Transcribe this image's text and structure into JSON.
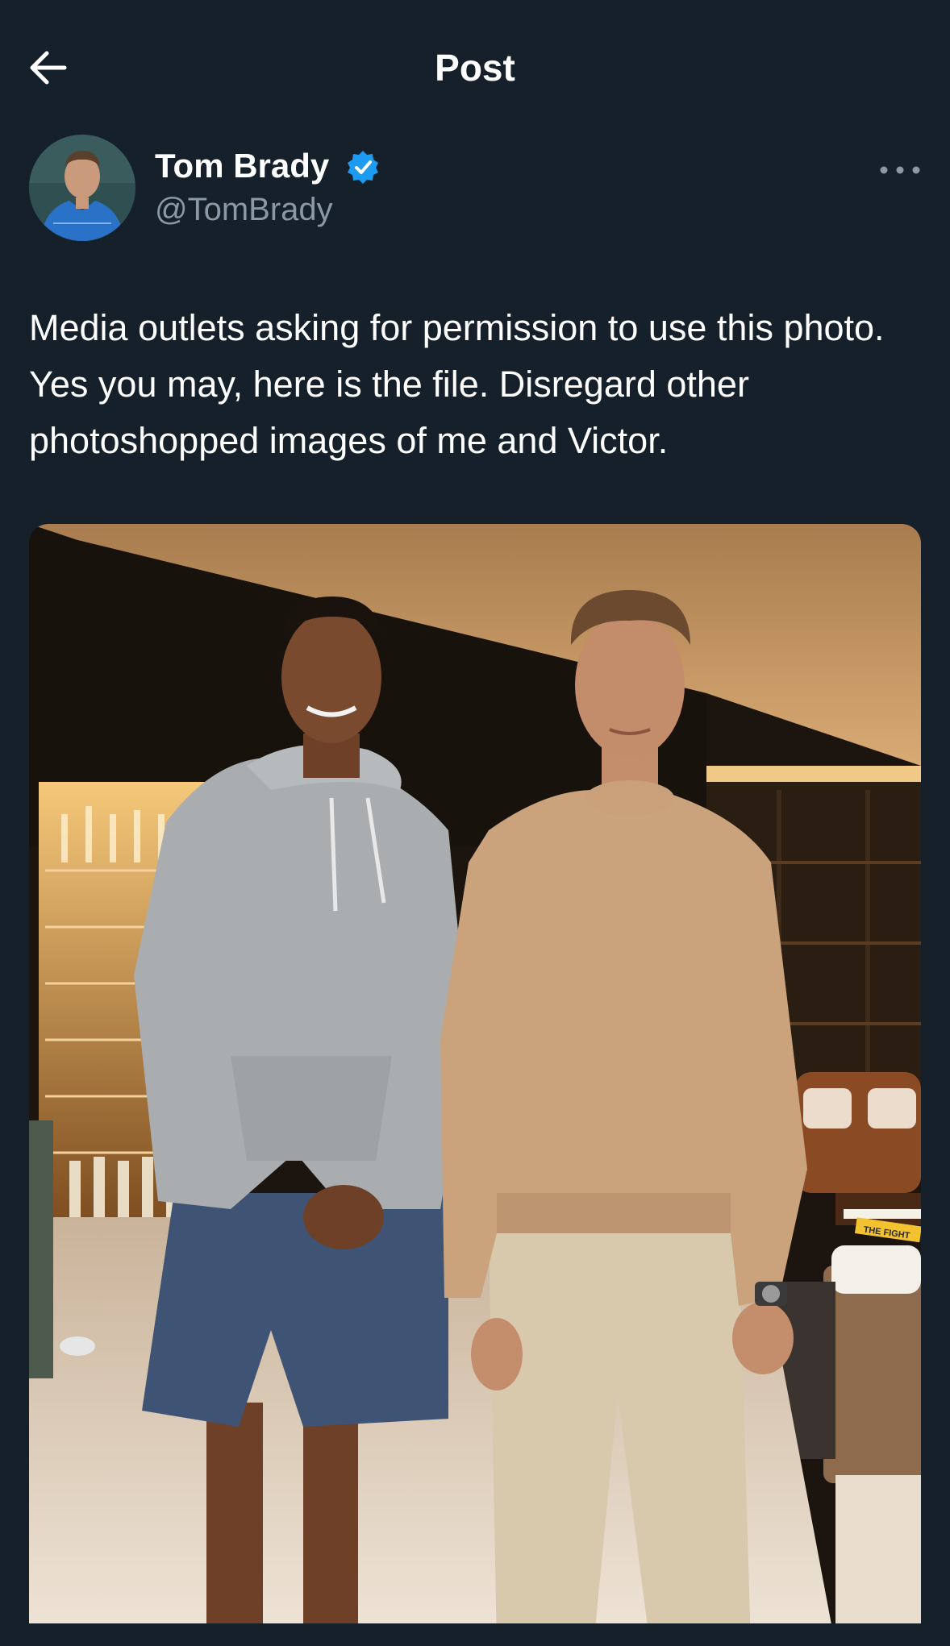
{
  "header": {
    "title": "Post",
    "back_icon": "arrow-left-icon"
  },
  "author": {
    "display_name": "Tom Brady",
    "handle": "@TomBrady",
    "verified": true,
    "verified_icon": "verified-badge-icon",
    "more_icon": "more-horizontal-icon"
  },
  "post": {
    "text": "Media outlets asking for permission to use this photo. Yes you may, here is the file. Disregard other photoshopped images of me and Victor.",
    "media": {
      "image_label": "photo",
      "book_spine_text": "THE FIGHT"
    }
  },
  "colors": {
    "background": "#15202b",
    "text_primary": "#ffffff",
    "text_secondary": "#8b98a5",
    "verified_blue": "#1d9bf0"
  }
}
